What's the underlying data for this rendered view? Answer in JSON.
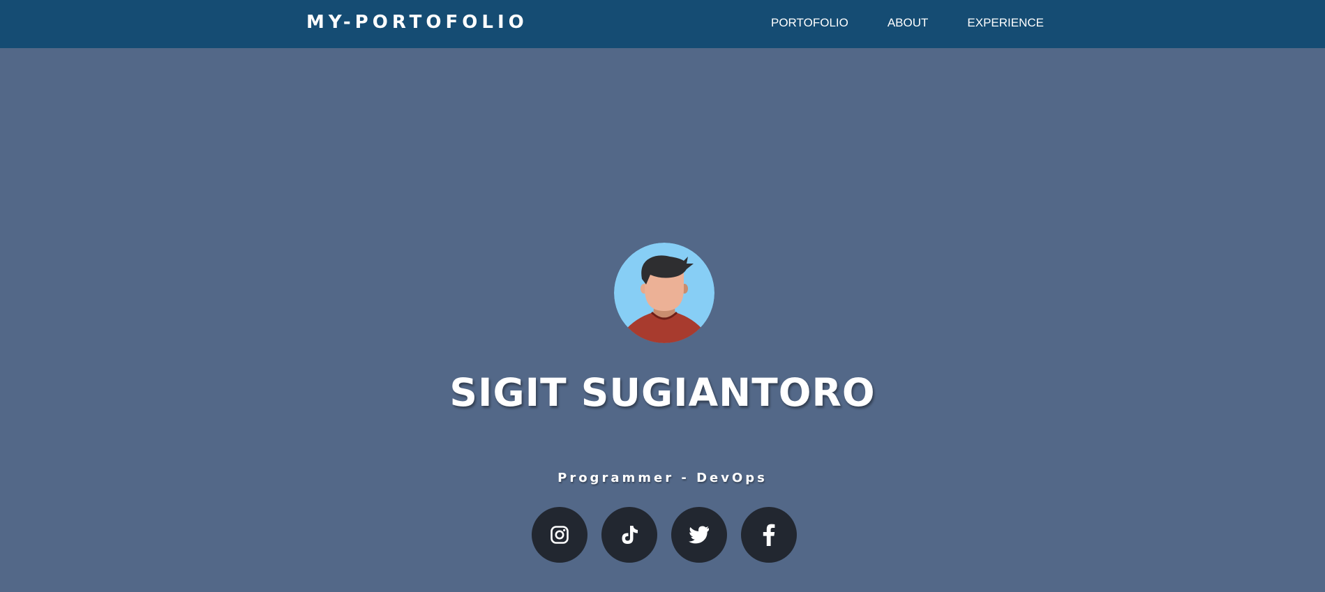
{
  "navbar": {
    "brand": "MY-PORTOFOLIO",
    "links": [
      {
        "label": "PORTOFOLIO"
      },
      {
        "label": "ABOUT"
      },
      {
        "label": "EXPERIENCE"
      }
    ]
  },
  "hero": {
    "avatar_icon": "person-avatar-icon",
    "name": "SIGIT SUGIANTORO",
    "role": "Programmer - DevOps",
    "socials": [
      {
        "icon": "instagram-icon"
      },
      {
        "icon": "tiktok-icon"
      },
      {
        "icon": "twitter-icon"
      },
      {
        "icon": "facebook-icon"
      }
    ]
  },
  "colors": {
    "navbar_bg": "#154c73",
    "page_bg": "#536888",
    "social_button_bg": "#222730",
    "avatar_bg": "#87cef5",
    "text": "#ffffff"
  }
}
